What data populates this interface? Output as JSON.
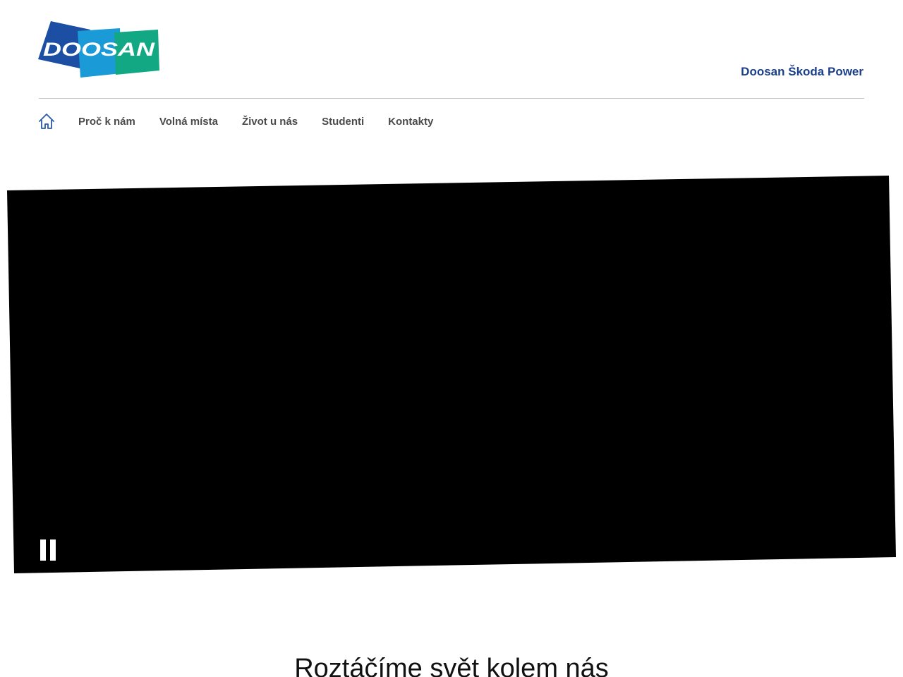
{
  "header": {
    "logo_text": "DOOSAN",
    "company_name": "Doosan Škoda Power"
  },
  "nav": {
    "home_icon": "home-icon",
    "items": [
      {
        "label": "Proč k nám"
      },
      {
        "label": "Volná místa"
      },
      {
        "label": "Život u nás"
      },
      {
        "label": "Studenti"
      },
      {
        "label": "Kontakty"
      }
    ]
  },
  "hero": {
    "control_icon": "pause-icon"
  },
  "main": {
    "headline": "Roztáčíme svět kolem nás"
  },
  "colors": {
    "brand_blue": "#1b3f8a",
    "logo_dark_blue": "#1c4fa3",
    "logo_light_blue": "#1a9ad6",
    "logo_green": "#11a883",
    "nav_text": "#4a4a4a",
    "video_bg": "#000000"
  }
}
